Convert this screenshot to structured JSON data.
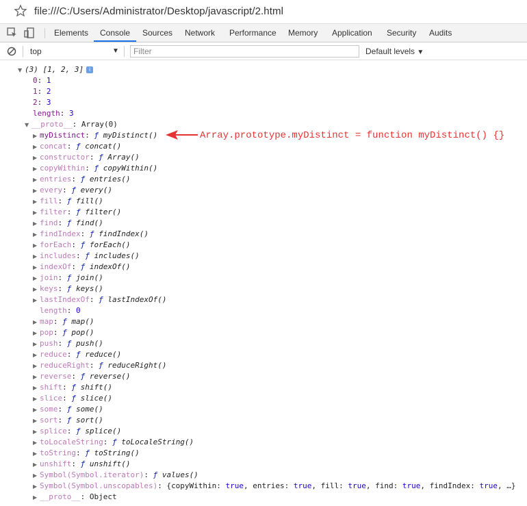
{
  "address": {
    "url": "file:///C:/Users/Administrator/Desktop/javascript/2.html"
  },
  "tabs": [
    "Elements",
    "Console",
    "Sources",
    "Network",
    "Performance",
    "Memory",
    "Application",
    "Security",
    "Audits"
  ],
  "console_toolbar": {
    "context": "top",
    "filter_placeholder": "Filter",
    "levels": "Default levels"
  },
  "summary": {
    "count": "(3)",
    "preview": "[1, 2, 3]",
    "info": "i"
  },
  "entries": [
    {
      "key": "0",
      "value": "1"
    },
    {
      "key": "1",
      "value": "2"
    },
    {
      "key": "2",
      "value": "3"
    },
    {
      "key": "length",
      "value": "3"
    }
  ],
  "proto": {
    "key": "__proto__",
    "value": "Array(0)"
  },
  "methods": [
    {
      "key": "myDistinct",
      "fn": "myDistinct()"
    },
    {
      "key": "concat",
      "fn": "concat()"
    },
    {
      "key": "constructor",
      "fn": "Array()"
    },
    {
      "key": "copyWithin",
      "fn": "copyWithin()"
    },
    {
      "key": "entries",
      "fn": "entries()"
    },
    {
      "key": "every",
      "fn": "every()"
    },
    {
      "key": "fill",
      "fn": "fill()"
    },
    {
      "key": "filter",
      "fn": "filter()"
    },
    {
      "key": "find",
      "fn": "find()"
    },
    {
      "key": "findIndex",
      "fn": "findIndex()"
    },
    {
      "key": "forEach",
      "fn": "forEach()"
    },
    {
      "key": "includes",
      "fn": "includes()"
    },
    {
      "key": "indexOf",
      "fn": "indexOf()"
    },
    {
      "key": "join",
      "fn": "join()"
    },
    {
      "key": "keys",
      "fn": "keys()"
    },
    {
      "key": "lastIndexOf",
      "fn": "lastIndexOf()"
    }
  ],
  "proto_length": {
    "key": "length",
    "value": "0"
  },
  "methods2": [
    {
      "key": "map",
      "fn": "map()"
    },
    {
      "key": "pop",
      "fn": "pop()"
    },
    {
      "key": "push",
      "fn": "push()"
    },
    {
      "key": "reduce",
      "fn": "reduce()"
    },
    {
      "key": "reduceRight",
      "fn": "reduceRight()"
    },
    {
      "key": "reverse",
      "fn": "reverse()"
    },
    {
      "key": "shift",
      "fn": "shift()"
    },
    {
      "key": "slice",
      "fn": "slice()"
    },
    {
      "key": "some",
      "fn": "some()"
    },
    {
      "key": "sort",
      "fn": "sort()"
    },
    {
      "key": "splice",
      "fn": "splice()"
    },
    {
      "key": "toLocaleString",
      "fn": "toLocaleString()"
    },
    {
      "key": "toString",
      "fn": "toString()"
    },
    {
      "key": "unshift",
      "fn": "unshift()"
    },
    {
      "key": "Symbol(Symbol.iterator)",
      "fn": "values()"
    }
  ],
  "unscopables": {
    "key": "Symbol(Symbol.unscopables)",
    "pairs": [
      {
        "k": "copyWithin",
        "v": "true"
      },
      {
        "k": "entries",
        "v": "true"
      },
      {
        "k": "fill",
        "v": "true"
      },
      {
        "k": "find",
        "v": "true"
      },
      {
        "k": "findIndex",
        "v": "true"
      }
    ],
    "ellipsis": "…}"
  },
  "proto_proto": {
    "key": "__proto__",
    "value": "Object"
  },
  "fn_symbol": "ƒ",
  "annotation": "Array.prototype.myDistinct = function myDistinct() {}",
  "colors": {
    "accent_tab": "#1a73e8",
    "key": "#881391",
    "number": "#1c00cf",
    "annotation": "#e53333"
  }
}
